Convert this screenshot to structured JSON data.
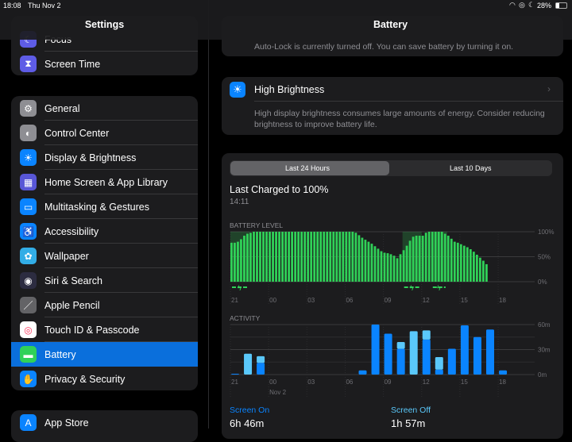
{
  "status_bar": {
    "time": "18:08",
    "date": "Thu Nov 2",
    "battery": "28%",
    "battery_level": 0.28
  },
  "sidebar": {
    "title": "Settings",
    "group1": [
      {
        "label": "Focus",
        "icon": "moon-icon",
        "color": "#5e5ce6"
      },
      {
        "label": "Screen Time",
        "icon": "hourglass-icon",
        "color": "#5e5ce6"
      }
    ],
    "group2": [
      {
        "label": "General",
        "icon": "gear-icon",
        "color": "#8e8e93"
      },
      {
        "label": "Control Center",
        "icon": "toggles-icon",
        "color": "#8e8e93"
      },
      {
        "label": "Display & Brightness",
        "icon": "sun-icon",
        "color": "#0a84ff"
      },
      {
        "label": "Home Screen & App Library",
        "icon": "app-grid-icon",
        "color": "#5856d6"
      },
      {
        "label": "Multitasking & Gestures",
        "icon": "multitasking-icon",
        "color": "#0a84ff"
      },
      {
        "label": "Accessibility",
        "icon": "accessibility-icon",
        "color": "#0a84ff"
      },
      {
        "label": "Wallpaper",
        "icon": "flower-icon",
        "color": "#32ade6"
      },
      {
        "label": "Siri & Search",
        "icon": "siri-icon",
        "color": "#2c2c40"
      },
      {
        "label": "Apple Pencil",
        "icon": "pencil-icon",
        "color": "#636366"
      },
      {
        "label": "Touch ID & Passcode",
        "icon": "fingerprint-icon",
        "color": "#ffffff"
      },
      {
        "label": "Battery",
        "icon": "battery-icon",
        "color": "#30d158",
        "selected": true
      },
      {
        "label": "Privacy & Security",
        "icon": "hand-icon",
        "color": "#0a84ff"
      }
    ],
    "group3": [
      {
        "label": "App Store",
        "icon": "app-store-icon",
        "color": "#0a84ff"
      }
    ]
  },
  "main": {
    "title": "Battery",
    "autolock_note": "Auto-Lock is currently turned off. You can save battery by turning it on.",
    "high_brightness": {
      "label": "High Brightness",
      "description_line1": "High display brightness consumes large amounts of energy. Consider reducing",
      "description_line2": "brightness to improve battery life."
    },
    "tabs": [
      "Last 24 Hours",
      "Last 10 Days"
    ],
    "active_tab": 0,
    "last_charged": "Last Charged to 100%",
    "last_charged_time": "14:11",
    "screen_on_label": "Screen On",
    "screen_on_value": "6h 46m",
    "screen_off_label": "Screen Off",
    "screen_off_value": "1h 57m"
  },
  "chart_data": [
    {
      "type": "bar",
      "title": "BATTERY LEVEL",
      "x_ticks": [
        "21",
        "00",
        "03",
        "06",
        "09",
        "12",
        "15",
        "18"
      ],
      "y_ticks": [
        "100%",
        "50%",
        "0%"
      ],
      "ylim": [
        0,
        100
      ],
      "interval": "15 min",
      "start": "21:00",
      "color": "#30d158",
      "values": [
        78,
        78,
        80,
        85,
        92,
        96,
        98,
        100,
        100,
        100,
        100,
        100,
        100,
        100,
        100,
        100,
        100,
        100,
        100,
        100,
        100,
        100,
        100,
        100,
        100,
        100,
        100,
        100,
        100,
        100,
        100,
        100,
        100,
        100,
        100,
        100,
        100,
        100,
        100,
        98,
        93,
        88,
        84,
        80,
        76,
        71,
        66,
        61,
        58,
        57,
        55,
        52,
        47,
        55,
        63,
        72,
        82,
        90,
        92,
        92,
        92,
        98,
        100,
        100,
        100,
        100,
        100,
        96,
        92,
        86,
        80,
        78,
        75,
        72,
        69,
        65,
        60,
        54,
        48,
        42,
        35
      ],
      "charging_periods": [
        [
          "21:00",
          "22:30"
        ],
        [
          "10:30",
          "12:00"
        ],
        [
          "12:45",
          "14:00"
        ]
      ]
    },
    {
      "type": "bar",
      "title": "ACTIVITY",
      "x_ticks": [
        "21",
        "00",
        "03",
        "06",
        "09",
        "12",
        "15",
        "18"
      ],
      "x_subtick": "Nov 2",
      "y_ticks": [
        "60m",
        "30m",
        "0m"
      ],
      "ylim": [
        0,
        60
      ],
      "stacked": true,
      "categories": [
        "21",
        "22",
        "23",
        "00",
        "01",
        "02",
        "03",
        "04",
        "05",
        "06",
        "07",
        "08",
        "09",
        "10",
        "11",
        "12",
        "13",
        "14",
        "15",
        "16",
        "17",
        "18"
      ],
      "series": [
        {
          "name": "Screen On",
          "color": "#0a84ff",
          "values": [
            1,
            0,
            14,
            0,
            0,
            0,
            0,
            0,
            0,
            0,
            5,
            60,
            49,
            31,
            0,
            42,
            6,
            31,
            59,
            45,
            54,
            5
          ]
        },
        {
          "name": "Screen Off",
          "color": "#5ac8fa",
          "values": [
            0,
            25,
            8,
            0,
            0,
            0,
            0,
            0,
            0,
            0,
            0,
            0,
            0,
            8,
            52,
            11,
            15,
            0,
            0,
            0,
            0,
            0
          ]
        }
      ]
    }
  ]
}
